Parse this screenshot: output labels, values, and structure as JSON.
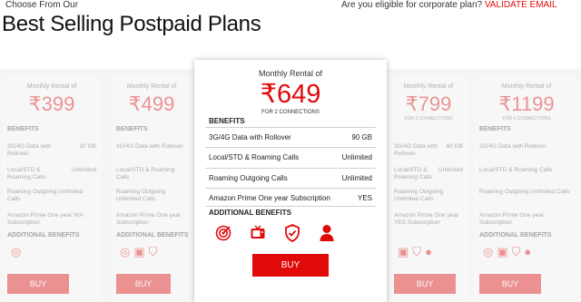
{
  "header": {
    "eyebrow": "Choose From Our",
    "title": "Best Selling Postpaid Plans",
    "corporate_question": "Are you eligible for corporate plan?",
    "corporate_link": "VALIDATE EMAIL"
  },
  "labels": {
    "monthly_rental": "Monthly Rental of",
    "benefits": "BENEFITS",
    "additional_benefits": "ADDITIONAL BENEFITS",
    "buy": "BUY"
  },
  "featured_plan": {
    "price": "₹649",
    "connections": "FOR 2 CONNECTIONS",
    "benefits": [
      {
        "name": "3G/4G Data with Rollover",
        "value": "90 GB"
      },
      {
        "name": "Local/STD & Roaming Calls",
        "value": "Unlimited"
      },
      {
        "name": "Roaming Outgoing Calls",
        "value": "Unlimited"
      },
      {
        "name": "Amazon Prime One year Subscription",
        "value": "YES"
      }
    ],
    "additional_icons": [
      "target-icon",
      "tv-icon",
      "shield-icon",
      "person-icon"
    ]
  },
  "background_plans": [
    {
      "price": "₹399",
      "connections": "",
      "data_label": "3G/4G Data with Rollover",
      "data_value": "20 GB",
      "calls_label": "Local/STD & Roaming Calls",
      "calls_value": "Unlimited",
      "roam_label": "Roaming Outgoing Unlimited Calls",
      "prime_label": "Amazon Prime One year N/A Subscription"
    },
    {
      "price": "₹499",
      "connections": "",
      "data_label": "3G/4G Data with Rollover",
      "data_value": "",
      "calls_label": "Local/STD & Roaming Calls",
      "calls_value": "",
      "roam_label": "Roaming Outgoing Unlimited Calls",
      "prime_label": "Amazon Prime One year Subscription"
    },
    {
      "price": "₹799",
      "connections": "FOR 3 CONNECTIONS",
      "data_label": "3G/4G Data with Rollover",
      "data_value": "60 GB",
      "calls_label": "Local/STD & Roaming Calls",
      "calls_value": "Unlimited",
      "roam_label": "Roaming Outgoing Unlimited Calls",
      "prime_label": "Amazon Prime One year YES Subscription"
    },
    {
      "price": "₹1199",
      "connections": "FOR 4 CONNECTIONS",
      "data_label": "3G/4G Data with Rollover",
      "data_value": "",
      "calls_label": "Local/STD & Roaming Calls",
      "calls_value": "",
      "roam_label": "Roaming Outgoing Unlimited Calls",
      "prime_label": "Amazon Prime One year Subscription"
    }
  ],
  "colors": {
    "accent": "#e10a0a",
    "background_strip": "#f5f5f5"
  }
}
